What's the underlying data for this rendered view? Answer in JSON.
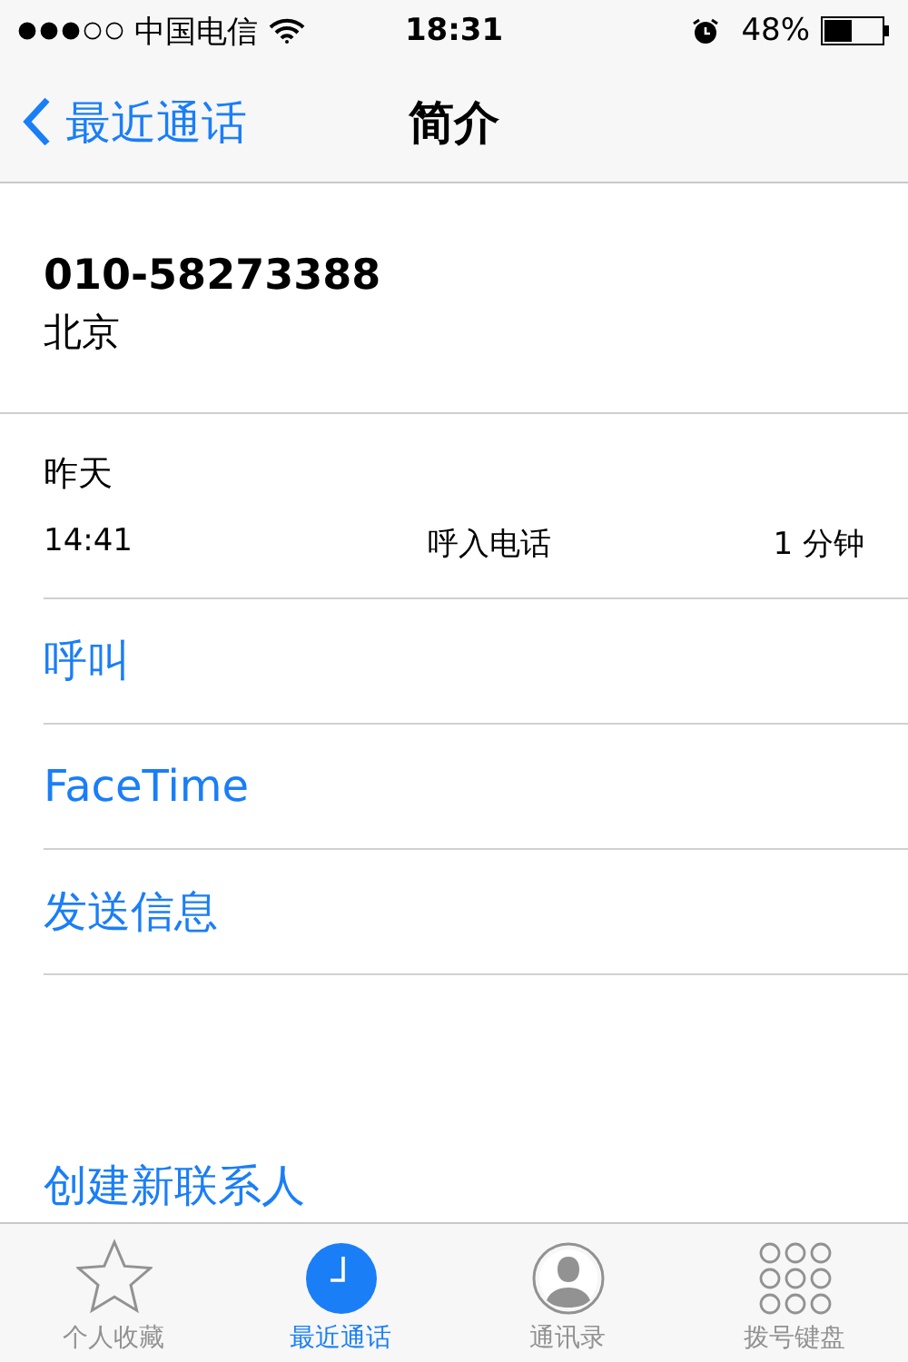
{
  "status_bar": {
    "carrier": "中国电信",
    "time": "18:31",
    "battery": "48%"
  },
  "nav": {
    "back": "最近通话",
    "title": "简介"
  },
  "contact": {
    "number": "010-58273388",
    "location": "北京"
  },
  "call_log": {
    "date": "昨天",
    "time": "14:41",
    "type": "呼入电话",
    "duration": "1 分钟"
  },
  "actions": [
    "呼叫",
    "FaceTime",
    "发送信息"
  ],
  "create_contact": "创建新联系人",
  "tabs": [
    {
      "kind": "favorites",
      "label": "个人收藏",
      "selected": false
    },
    {
      "kind": "recents",
      "label": "最近通话",
      "selected": true
    },
    {
      "kind": "contacts",
      "label": "通讯录",
      "selected": false
    },
    {
      "kind": "keypad",
      "label": "拨号键盘",
      "selected": false
    }
  ]
}
